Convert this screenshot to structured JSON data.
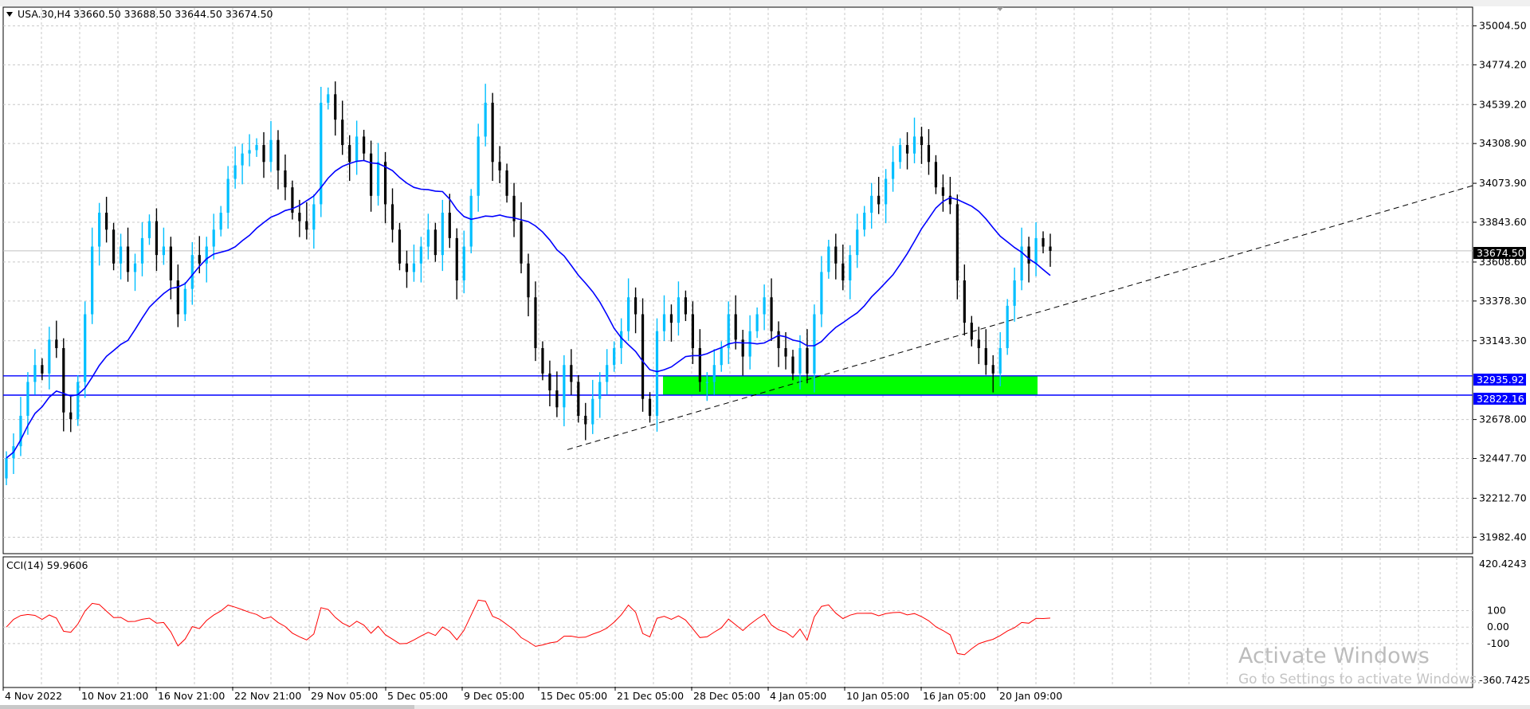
{
  "header": {
    "symbol": "USA.30,H4",
    "ohlc": "33660.50 33688.50 33644.50 33674.50"
  },
  "indicator": {
    "label": "CCI(14) 59.9606"
  },
  "price_axis": {
    "ticks": [
      "35004.50",
      "34774.20",
      "34539.20",
      "34308.90",
      "34073.90",
      "33843.60",
      "33608.60",
      "33378.30",
      "33143.30",
      "32678.00",
      "32447.70",
      "32212.70",
      "31982.40"
    ],
    "last_price_tag": "33674.50",
    "level_tags": [
      "32935.92",
      "32822.16"
    ]
  },
  "cci_axis": {
    "ticks": [
      "420.4243",
      "100",
      "0.00",
      "-100",
      "-360.7425"
    ]
  },
  "time_axis": {
    "ticks": [
      "4 Nov 2022",
      "10 Nov 21:00",
      "16 Nov 21:00",
      "22 Nov 21:00",
      "29 Nov 05:00",
      "5 Dec 05:00",
      "9 Dec 05:00",
      "15 Dec 05:00",
      "21 Dec 05:00",
      "28 Dec 05:00",
      "4 Jan 05:00",
      "10 Jan 05:00",
      "16 Jan 05:00",
      "20 Jan 09:00"
    ]
  },
  "watermark": {
    "title": "Activate Windows",
    "subtitle": "Go to Settings to activate Windows."
  },
  "colors": {
    "bull": "#00bfff",
    "bear": "#000000",
    "ma": "#0000ff",
    "level": "#0000ff",
    "zone": "#00ff00",
    "cci": "#ff0000",
    "grid": "#c8c8c8",
    "tag_bg": "#0000ff",
    "last_tag_bg": "#000000"
  },
  "chart_data": [
    {
      "type": "candlestick",
      "symbol": "USA.30",
      "timeframe": "H4",
      "y_range": [
        31890,
        35110
      ],
      "close_series": [
        32450,
        32520,
        32700,
        32900,
        33000,
        32950,
        33150,
        33100,
        32720,
        32680,
        32900,
        33300,
        33700,
        33900,
        33800,
        33600,
        33700,
        33550,
        33600,
        33750,
        33850,
        33650,
        33700,
        33500,
        33300,
        33450,
        33650,
        33600,
        33700,
        33800,
        33900,
        34100,
        34180,
        34250,
        34270,
        34300,
        34200,
        34330,
        34150,
        34050,
        33900,
        33850,
        33800,
        33950,
        34550,
        34600,
        34450,
        34300,
        34200,
        34350,
        34250,
        34000,
        34200,
        33950,
        33800,
        33600,
        33550,
        33600,
        33700,
        33800,
        33650,
        33900,
        33750,
        33500,
        33700,
        34000,
        34350,
        34550,
        34200,
        34150,
        34000,
        33850,
        33600,
        33400,
        33100,
        32950,
        32850,
        32750,
        33000,
        32900,
        32700,
        32650,
        32800,
        32900,
        33000,
        33100,
        33200,
        33400,
        33300,
        32800,
        32700,
        33200,
        33300,
        33250,
        33400,
        33300,
        33100,
        32900,
        32900,
        33000,
        33100,
        33300,
        33150,
        33050,
        33200,
        33300,
        33400,
        33200,
        33100,
        33050,
        32950,
        33100,
        32950,
        33300,
        33550,
        33700,
        33600,
        33500,
        33650,
        33800,
        33900,
        34000,
        33950,
        34100,
        34200,
        34300,
        34250,
        34350,
        34300,
        34200,
        34050,
        34000,
        33950,
        33500,
        33250,
        33150,
        33100,
        33000,
        32950,
        33100,
        33350,
        33500,
        33700,
        33600,
        33750,
        33700,
        33674.5
      ],
      "moving_average": {
        "type": "line",
        "approx_values_at": {
          "start": 32450,
          "5 Dec": 34180,
          "15 Dec": 33960,
          "28 Dec": 33130,
          "4 Jan": 33180,
          "16 Jan": 33920,
          "last": 33750
        }
      },
      "horizontal_levels": [
        32935.92,
        32822.16
      ],
      "support_zone": {
        "low": 32822.16,
        "high": 32935.92,
        "from": "21 Dec 05:00",
        "to": "20 Jan 09:00"
      },
      "trendline": {
        "style": "dashed",
        "from": {
          "time": "15 Dec 05:00",
          "price": 32500
        },
        "to_price_right_edge": 34060
      },
      "last_price": 33674.5
    },
    {
      "type": "line",
      "name": "CCI(14)",
      "y_range": [
        -360.7425,
        420.4243
      ],
      "reference_levels": [
        100,
        0,
        -100
      ],
      "last_value": 59.9606
    }
  ]
}
